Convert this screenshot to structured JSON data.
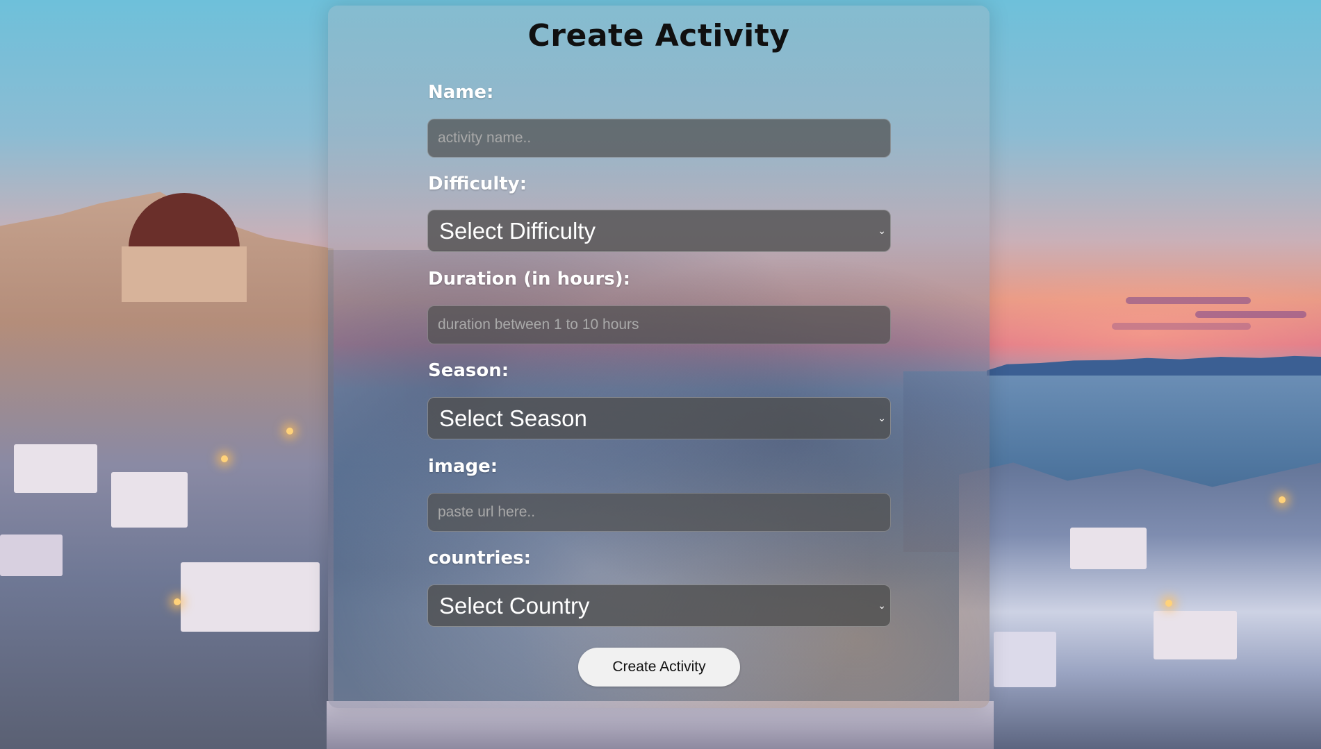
{
  "form": {
    "title": "Create Activity",
    "name_label": "Name:",
    "name_placeholder": "activity name..",
    "name_value": "",
    "difficulty_label": "Difficulty:",
    "difficulty_selected": "Select Difficulty",
    "duration_label": "Duration (in hours):",
    "duration_placeholder": "duration between 1 to 10 hours",
    "duration_value": "",
    "season_label": "Season:",
    "season_selected": "Select Season",
    "image_label": "image:",
    "image_placeholder": "paste url here..",
    "image_value": "",
    "countries_label": "countries:",
    "countries_selected": "Select Country",
    "submit_label": "Create Activity",
    "dropdown_icon": "chevron-down-icon"
  },
  "colors": {
    "field_background": "#505050",
    "label_text": "#ffffff",
    "title_text": "#101010",
    "button_background": "#f1f1f1"
  }
}
